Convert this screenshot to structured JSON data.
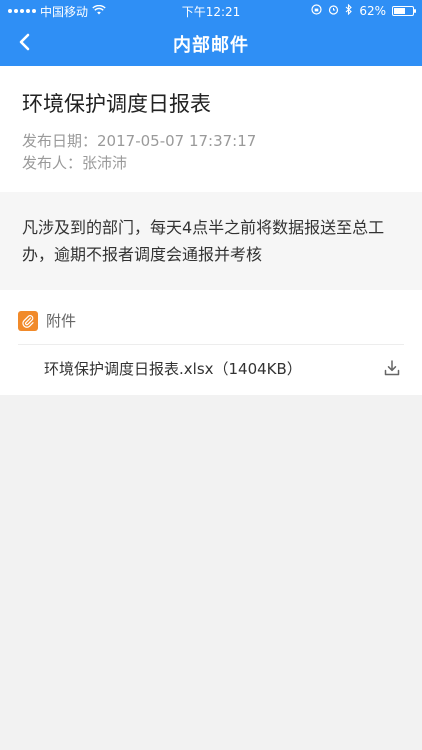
{
  "statusbar": {
    "carrier": "中国移动",
    "time": "下午12:21",
    "battery_percent": "62%",
    "battery_level": 0.62
  },
  "navbar": {
    "title": "内部邮件",
    "back_icon": "chevron-left-icon"
  },
  "mail": {
    "subject": "环境保护调度日报表",
    "publish_date_label": "发布日期：",
    "publish_date": "2017-05-07 17:37:17",
    "publisher_label": "发布人：",
    "publisher": "张沛沛",
    "body": "凡涉及到的部门，每天4点半之前将数据报送至总工办，逾期不报者调度会通报并考核"
  },
  "attachments": {
    "label": "附件",
    "icon": "paperclip-icon",
    "items": [
      {
        "name": "环境保护调度日报表.xlsx（1404KB）",
        "action_icon": "download-icon"
      }
    ]
  },
  "colors": {
    "primary": "#2f8ff5",
    "attachment_badge": "#f18a2a"
  }
}
